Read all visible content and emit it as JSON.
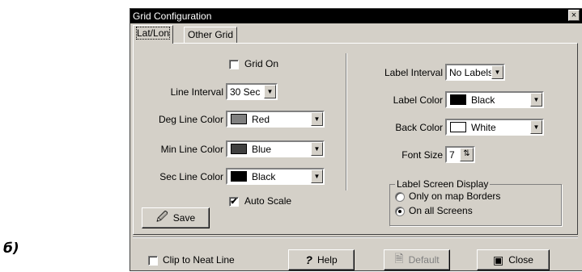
{
  "caption": "б)",
  "dialog": {
    "title": "Grid Configuration",
    "close_glyph": "×",
    "tabs": [
      {
        "label": "Lat/Lon",
        "active": true
      },
      {
        "label": "Other Grid",
        "active": false
      }
    ]
  },
  "left": {
    "grid_on": {
      "label": "Grid On",
      "checked": false
    },
    "line_interval": {
      "label": "Line Interval",
      "value": "30 Sec"
    },
    "deg_line_color": {
      "label": "Deg Line Color",
      "value": "Red",
      "swatch": "#808080"
    },
    "min_line_color": {
      "label": "Min Line Color",
      "value": "Blue",
      "swatch": "#404040"
    },
    "sec_line_color": {
      "label": "Sec Line Color",
      "value": "Black",
      "swatch": "#000000"
    },
    "auto_scale": {
      "label": "Auto Scale",
      "checked": true,
      "mark": "✔"
    },
    "save_button": {
      "label": "Save",
      "icon": "save-icon"
    }
  },
  "right": {
    "label_interval": {
      "label": "Label Interval",
      "value": "No Labels"
    },
    "label_color": {
      "label": "Label Color",
      "value": "Black",
      "swatch": "#000000"
    },
    "back_color": {
      "label": "Back Color",
      "value": "White",
      "swatch": "#ffffff"
    },
    "font_size": {
      "label": "Font Size",
      "value": "7"
    },
    "label_screen_display": {
      "title": "Label Screen Display",
      "options": [
        {
          "label": "Only on map Borders",
          "selected": false
        },
        {
          "label": "On all Screens",
          "selected": true
        }
      ]
    }
  },
  "footer": {
    "clip_to_neat_line": {
      "label": "Clip to Neat Line",
      "checked": false
    },
    "help_button": {
      "label": "Help",
      "icon": "question-icon"
    },
    "default_button": {
      "label": "Default",
      "icon": "default-icon",
      "enabled": false
    },
    "close_button": {
      "label": "Close",
      "icon": "close-dialog-icon"
    }
  }
}
